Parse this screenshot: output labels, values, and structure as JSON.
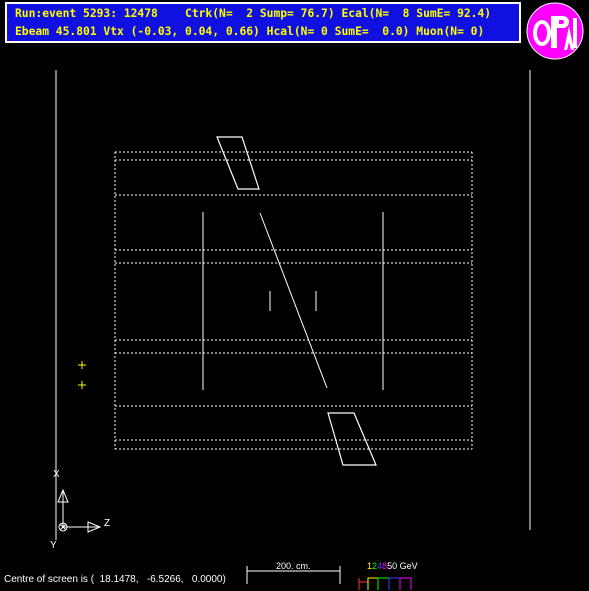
{
  "header": {
    "line1": "Run:event 5293: 12478    Ctrk(N=  2 Sump= 76.7) Ecal(N=  8 SumE= 92.4)",
    "line2": "Ebeam 45.801 Vtx (-0.03, 0.04, 0.66) Hcal(N= 0 SumE=  0.0) Muon(N= 0)"
  },
  "logo": {
    "text": "OPAL"
  },
  "axes": {
    "x": "X",
    "y": "Y",
    "z": "Z"
  },
  "scale": {
    "label": "200. cm."
  },
  "energy_legend": {
    "values": [
      "1",
      "2",
      "4",
      "8",
      "50 GeV"
    ],
    "colors": [
      "#ffff00",
      "#00ff00",
      "#4040ff",
      "#ff00ff",
      "#ffffff"
    ]
  },
  "footer": {
    "centre_text": "Centre of screen is (  18.1478,   -6.5266,   0.0000)"
  },
  "colors": {
    "header_bg": "#1010e0",
    "header_text": "#ffff00",
    "logo_bg": "#ff00ff"
  }
}
